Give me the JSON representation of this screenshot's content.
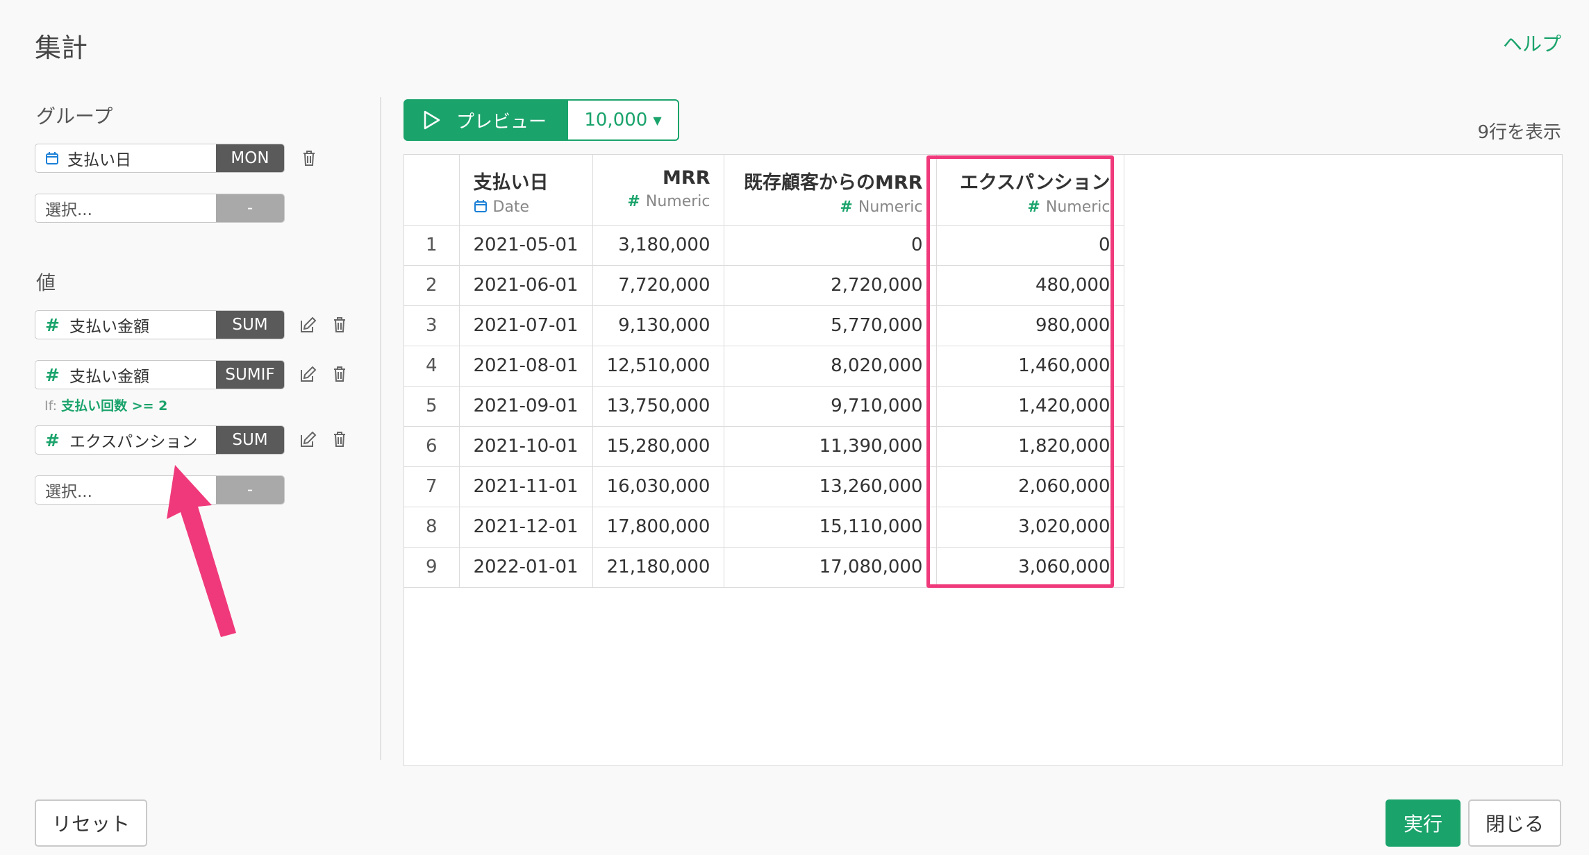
{
  "header": {
    "title": "集計",
    "help": "ヘルプ"
  },
  "left": {
    "group_label": "グループ",
    "group_fields": [
      {
        "name": "支払い日",
        "agg": "MON",
        "icon": "calendar-icon"
      },
      {
        "name": "選択...",
        "agg": "-"
      }
    ],
    "values_label": "値",
    "value_fields": [
      {
        "name": "支払い金額",
        "agg": "SUM"
      },
      {
        "name": "支払い金額",
        "agg": "SUMIF",
        "cond_prefix": "If:",
        "cond": "支払い回数 >= 2"
      },
      {
        "name": "エクスパンション",
        "agg": "SUM"
      },
      {
        "name": "選択...",
        "agg": "-"
      }
    ]
  },
  "toolbar": {
    "preview": "プレビュー",
    "rows": "10,000",
    "rows_count": "9行を表示"
  },
  "table": {
    "columns": [
      {
        "name": "支払い日",
        "type": "Date"
      },
      {
        "name": "MRR",
        "type": "Numeric"
      },
      {
        "name": "既存顧客からのMRR",
        "type": "Numeric"
      },
      {
        "name": "エクスパンション",
        "type": "Numeric"
      }
    ],
    "rows": [
      [
        "1",
        "2021-05-01",
        "3,180,000",
        "0",
        "0"
      ],
      [
        "2",
        "2021-06-01",
        "7,720,000",
        "2,720,000",
        "480,000"
      ],
      [
        "3",
        "2021-07-01",
        "9,130,000",
        "5,770,000",
        "980,000"
      ],
      [
        "4",
        "2021-08-01",
        "12,510,000",
        "8,020,000",
        "1,460,000"
      ],
      [
        "5",
        "2021-09-01",
        "13,750,000",
        "9,710,000",
        "1,420,000"
      ],
      [
        "6",
        "2021-10-01",
        "15,280,000",
        "11,390,000",
        "1,820,000"
      ],
      [
        "7",
        "2021-11-01",
        "16,030,000",
        "13,260,000",
        "2,060,000"
      ],
      [
        "8",
        "2021-12-01",
        "17,800,000",
        "15,110,000",
        "3,020,000"
      ],
      [
        "9",
        "2022-01-01",
        "21,180,000",
        "17,080,000",
        "3,060,000"
      ]
    ]
  },
  "footer": {
    "reset": "リセット",
    "run": "実行",
    "close": "閉じる"
  },
  "colors": {
    "accent": "#1aa36b",
    "highlight": "#f0397a",
    "agg_bg": "#5a5a5a"
  }
}
